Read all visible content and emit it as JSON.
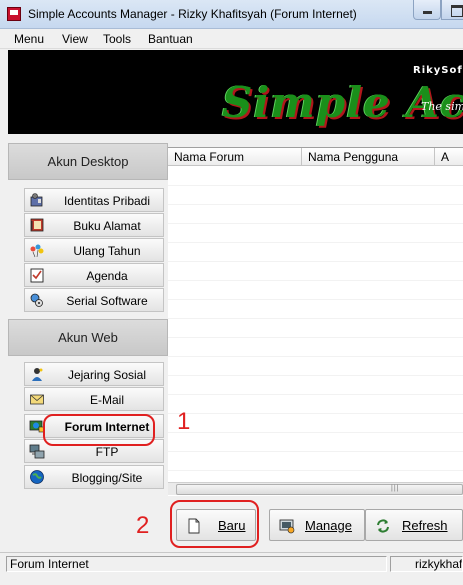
{
  "window": {
    "title": "Simple Accounts Manager - Rizky Khafitsyah (Forum Internet)"
  },
  "menu": {
    "items": [
      "Menu",
      "View",
      "Tools",
      "Bantuan"
    ]
  },
  "banner": {
    "brand": "RikySof",
    "title": "Simple Accoun",
    "subtitle": "The simp"
  },
  "sidebar": {
    "desktop_header": "Akun Desktop",
    "desktop_items": [
      {
        "label": "Identitas Pribadi",
        "icon": "id-card-icon"
      },
      {
        "label": "Buku Alamat",
        "icon": "address-book-icon"
      },
      {
        "label": "Ulang Tahun",
        "icon": "birthday-icon"
      },
      {
        "label": "Agenda",
        "icon": "agenda-icon"
      },
      {
        "label": "Serial Software",
        "icon": "software-key-icon"
      }
    ],
    "web_header": "Akun Web",
    "web_items": [
      {
        "label": "Jejaring Sosial",
        "icon": "social-network-icon"
      },
      {
        "label": "E-Mail",
        "icon": "email-icon"
      },
      {
        "label": "Forum Internet",
        "icon": "forum-icon",
        "selected": true
      },
      {
        "label": "FTP",
        "icon": "ftp-icon"
      },
      {
        "label": "Blogging/Site",
        "icon": "globe-icon"
      }
    ]
  },
  "table": {
    "columns": [
      "Nama Forum",
      "Nama Pengguna",
      "A"
    ]
  },
  "toolbar": {
    "new_label": "Baru",
    "manage_label": "Manage",
    "refresh_label": "Refresh"
  },
  "status": {
    "left": "Forum Internet",
    "right": "rizkykhaf"
  },
  "annotations": {
    "step1": "1",
    "step2": "2"
  },
  "colors": {
    "annotation": "#e02020",
    "banner_bg": "#000000",
    "banner_title_green": "#1a8f1a",
    "banner_title_red": "#b0171b"
  }
}
